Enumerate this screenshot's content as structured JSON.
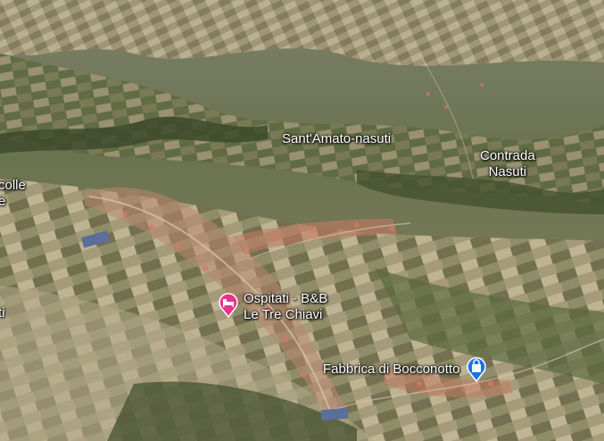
{
  "map": {
    "type": "satellite-3d",
    "colors": {
      "farmland_light": "#b9ad8c",
      "farmland_dark": "#5a6440",
      "forest": "#3d4a2c",
      "urban": "#c97b63",
      "water": "#5a6f9a"
    }
  },
  "places": [
    {
      "id": "santamato",
      "label": "Sant'Amato-nasuti"
    },
    {
      "id": "contrada",
      "line1": "Contrada",
      "line2": "Nasuti"
    },
    {
      "id": "colle",
      "line1": "colle",
      "line2": "e"
    },
    {
      "id": "ti",
      "label": "ti"
    }
  ],
  "pois": [
    {
      "id": "bnb",
      "line1": "Ospitati - B&B",
      "line2": "Le Tre Chiavi",
      "icon": "bed-icon",
      "color": "#e8338f"
    },
    {
      "id": "fabbrica",
      "line1": "Fabbrica di Bocconotto",
      "icon": "shopping-bag-icon",
      "color": "#1a73e8"
    }
  ]
}
